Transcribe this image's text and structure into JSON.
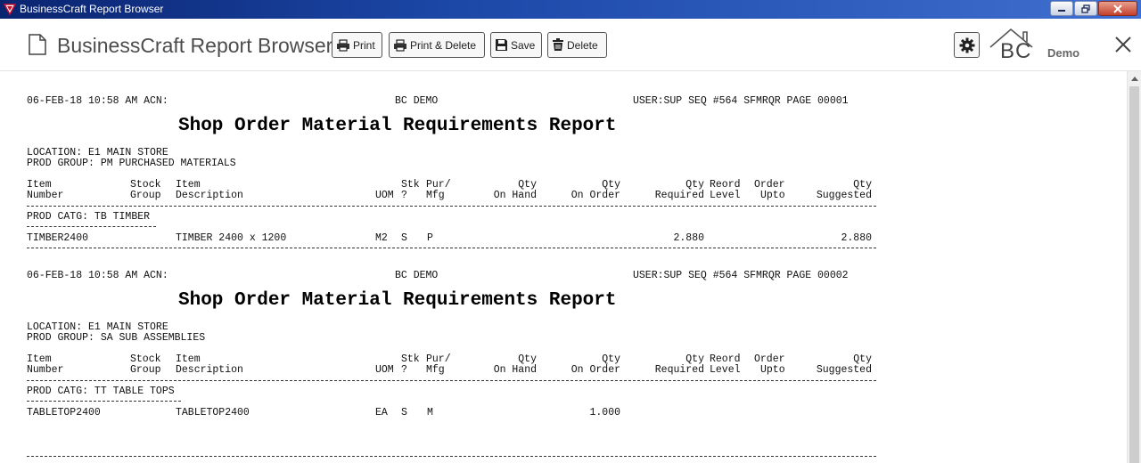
{
  "window": {
    "title": "BusinessCraft Report Browser"
  },
  "toolbar": {
    "app_title": "BusinessCraft Report Browser",
    "print_label": "Print",
    "print_delete_label": "Print & Delete",
    "save_label": "Save",
    "delete_label": "Delete",
    "logo_text": "BC",
    "company": "Demo"
  },
  "columns": {
    "item": [
      "Item",
      "Number"
    ],
    "stock": [
      "Stock",
      "Group"
    ],
    "desc": [
      "Item",
      "Description"
    ],
    "uom": "UOM",
    "stk": [
      "Stk",
      "?"
    ],
    "pur": [
      "Pur/",
      "Mfg"
    ],
    "onhand": [
      "Qty",
      "On Hand"
    ],
    "onorder": [
      "Qty",
      "On Order"
    ],
    "required": [
      "Qty",
      "Required"
    ],
    "reord": [
      "Reord",
      "Level"
    ],
    "order": [
      "Order",
      "Upto"
    ],
    "suggested": [
      "Qty",
      "Suggested"
    ]
  },
  "pages": [
    {
      "header_left": "06-FEB-18 10:58 AM ACN:",
      "header_center": "BC DEMO",
      "header_right": "USER:SUP SEQ #564 SFMRQR PAGE 00001",
      "title": "Shop Order Material Requirements Report",
      "location": "LOCATION: E1 MAIN STORE",
      "prod_group": "PROD GROUP: PM PURCHASED MATERIALS",
      "prod_catg": "PROD CATG: TB TIMBER",
      "row": {
        "item": "TIMBER2400",
        "desc": "TIMBER 2400 x 1200",
        "uom": "M2",
        "stk": "S",
        "pur": "P",
        "onorder": "",
        "required": "2.880",
        "suggested": "2.880"
      }
    },
    {
      "header_left": "06-FEB-18 10:58 AM ACN:",
      "header_center": "BC DEMO",
      "header_right": "USER:SUP SEQ #564 SFMRQR PAGE 00002",
      "title": "Shop Order Material Requirements Report",
      "location": "LOCATION: E1 MAIN STORE",
      "prod_group": "PROD GROUP: SA SUB ASSEMBLIES",
      "prod_catg": "PROD CATG: TT TABLE TOPS",
      "row": {
        "item": "TABLETOP2400",
        "desc": "TABLETOP2400",
        "uom": "EA",
        "stk": "S",
        "pur": "M",
        "onorder": "1.000",
        "required": "",
        "suggested": ""
      }
    }
  ]
}
